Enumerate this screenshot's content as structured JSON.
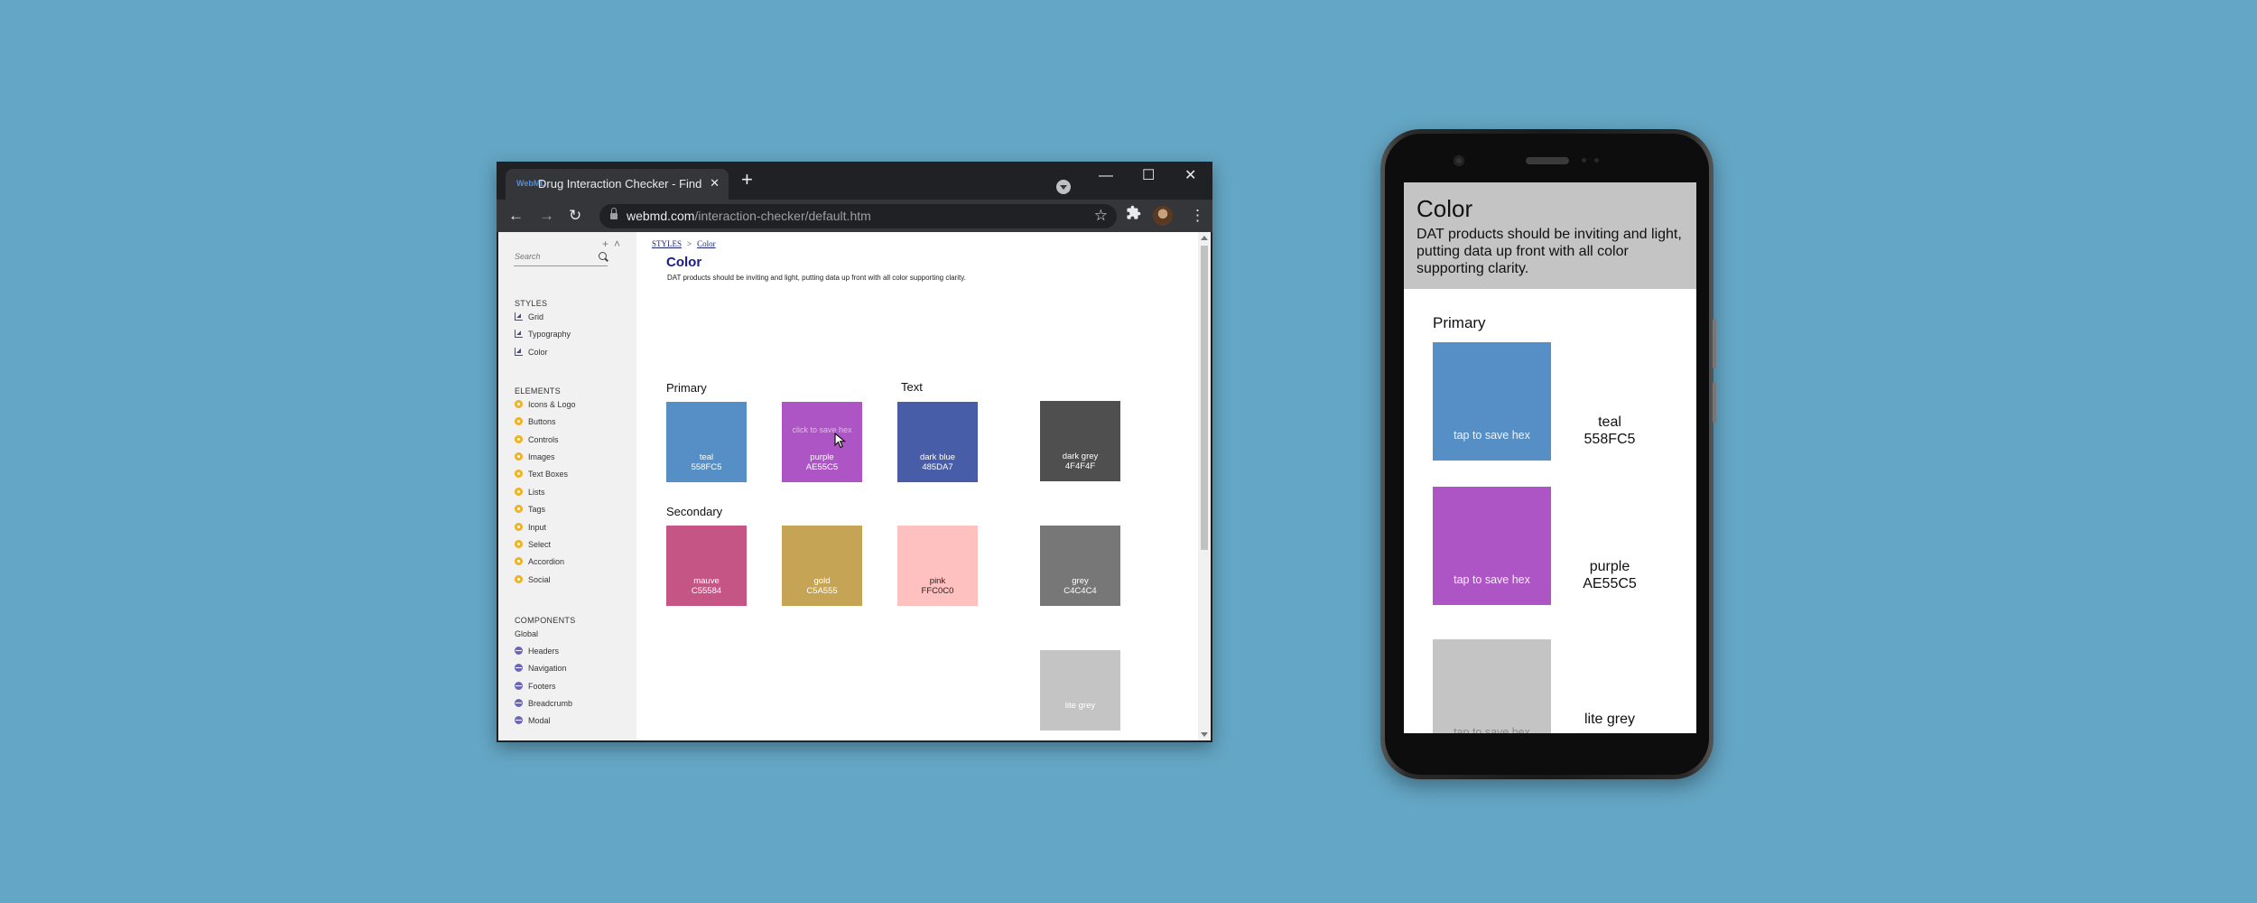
{
  "browser": {
    "tab_title": "Drug Interaction Checker - Find I",
    "tab_close": "✕",
    "new_tab": "+",
    "window_controls": {
      "minimize": "—",
      "maximize": "☐",
      "close": "✕"
    },
    "url_host": "webmd.com",
    "url_path": "/interaction-checker/default.htm",
    "nav_icons": {
      "back": "←",
      "forward": "→",
      "reload": "↻"
    }
  },
  "sidebar": {
    "search_placeholder": "Search",
    "sections": [
      {
        "title": "STYLES",
        "items": [
          "Grid",
          "Typography",
          "Color"
        ]
      },
      {
        "title": "ELEMENTS",
        "items": [
          "Icons & Logo",
          "Buttons",
          "Controls",
          "Images",
          "Text Boxes",
          "Lists",
          "Tags",
          "Input",
          "Select",
          "Accordion",
          "Social"
        ]
      },
      {
        "title": "COMPONENTS",
        "subtitle": "Global",
        "items": [
          "Headers",
          "Navigation",
          "Footers",
          "Breadcrumb",
          "Modal"
        ]
      }
    ]
  },
  "content": {
    "breadcrumb": {
      "parent": "STYLES",
      "separator": ">",
      "current": "Color"
    },
    "title": "Color",
    "description": "DAT products should be inviting and light, putting data up front with all color supporting clarity.",
    "groups": {
      "primary": "Primary",
      "secondary": "Secondary",
      "text": "Text"
    },
    "hover_hint": "click to save hex",
    "swatches": {
      "teal": {
        "name": "teal",
        "hex": "558FC5",
        "color": "#558fc5"
      },
      "purple": {
        "name": "purple",
        "hex": "AE55C5",
        "color": "#ae55c5"
      },
      "dark_blue": {
        "name": "dark blue",
        "hex": "485DA7",
        "color": "#485da7"
      },
      "mauve": {
        "name": "mauve",
        "hex": "C55584",
        "color": "#c55584"
      },
      "gold": {
        "name": "gold",
        "hex": "C5A555",
        "color": "#c5a555"
      },
      "pink": {
        "name": "pink",
        "hex": "FFC0C0",
        "color": "#ffc0c0"
      },
      "dark_grey": {
        "name": "dark grey",
        "hex": "4F4F4F",
        "color": "#4f4f4f"
      },
      "grey": {
        "name": "grey",
        "hex": "C4C4C4",
        "color": "#777777"
      },
      "lite_grey": {
        "name": "lite grey",
        "color": "#c4c4c4"
      }
    }
  },
  "mobile": {
    "title": "Color",
    "description": "DAT products should be inviting and light, putting data up front with all color supporting clarity.",
    "primary_label": "Primary",
    "hint": "tap to save hex",
    "swatches": [
      {
        "name": "teal",
        "hex": "558FC5",
        "color": "#558fc5"
      },
      {
        "name": "purple",
        "hex": "AE55C5",
        "color": "#ae55c5"
      },
      {
        "name": "lite grey",
        "color": "#c4c4c4"
      }
    ]
  },
  "colors": {
    "background": "#64a6c5",
    "chrome_dark": "#202124",
    "chrome_toolbar": "#35363a",
    "accent_title": "#1a1a8c"
  }
}
